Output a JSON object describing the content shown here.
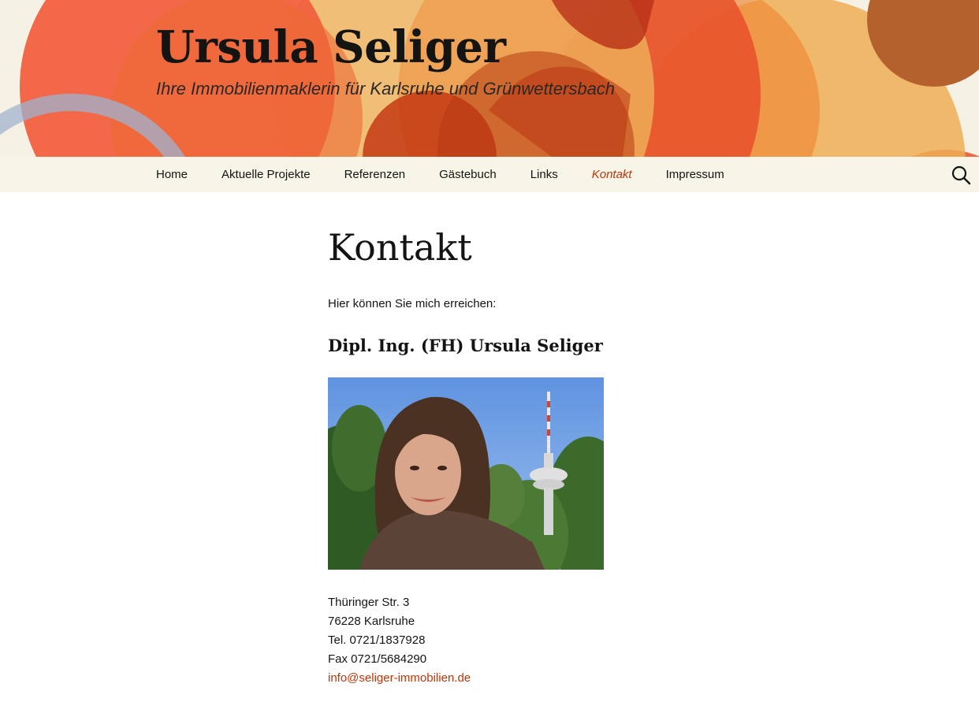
{
  "site": {
    "title": "Ursula Seliger",
    "description": "Ihre Immobilienmaklerin für Karlsruhe und Grünwettersbach"
  },
  "nav": {
    "items": [
      {
        "label": "Home"
      },
      {
        "label": "Aktuelle Projekte"
      },
      {
        "label": "Referenzen"
      },
      {
        "label": "Gästebuch"
      },
      {
        "label": "Links"
      },
      {
        "label": "Kontakt",
        "active": true
      },
      {
        "label": "Impressum"
      }
    ],
    "search_icon": "search-icon"
  },
  "page": {
    "title": "Kontakt",
    "intro": "Hier können Sie mich erreichen:",
    "person_name": "Dipl. Ing. (FH) Ursula Seliger",
    "photo_icon": "portrait-photo"
  },
  "contact": {
    "street": "Thüringer Str. 3",
    "city": "76228 Karlsruhe",
    "tel": "Tel. 0721/1837928",
    "fax": "Fax 0721/5684290",
    "email": "info@seliger-immobilien.de"
  },
  "colors": {
    "accent": "#bc360a",
    "nav_background": "#f7f5e7",
    "header_background": "#f5f1e4"
  }
}
